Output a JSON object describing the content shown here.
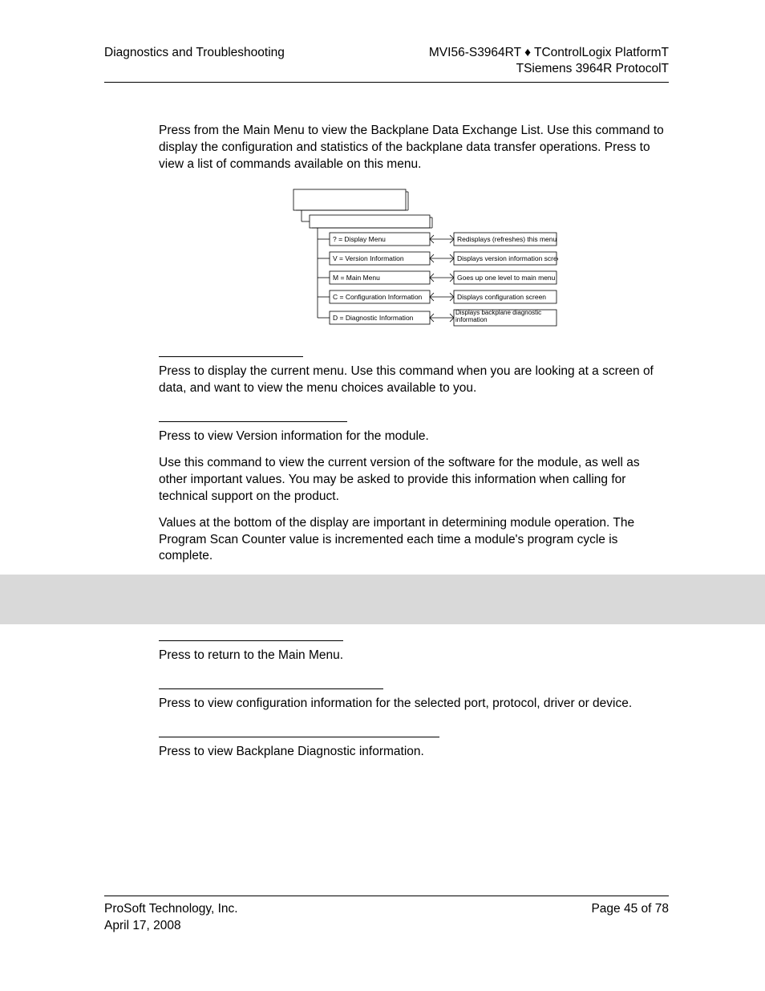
{
  "header": {
    "left": "Diagnostics and Troubleshooting",
    "right1": "MVI56-S3964RT ♦ TControlLogix PlatformT",
    "right2": "TSiemens 3964R ProtocolT"
  },
  "intro": "Press       from the Main Menu to view the Backplane Data Exchange List. Use this command to display the configuration and statistics of the backplane data transfer operations. Press       to view a list of commands available on this menu.",
  "menu_items": [
    {
      "left": "? = Display Menu",
      "right": "Redisplays (refreshes) this menu"
    },
    {
      "left": "V = Version Information",
      "right": "Displays version information screen"
    },
    {
      "left": "M = Main Menu",
      "right": "Goes up one level to main menu"
    },
    {
      "left": "C = Configuration Information",
      "right": "Displays configuration screen"
    },
    {
      "left": "D = Diagnostic Information",
      "right": "Displays backplane diagnostic information"
    }
  ],
  "sec1": "Press       to display the current menu. Use this command when you are looking at a screen of data, and want to view the menu choices available to you.",
  "sec2a": "Press       to view Version information for the module.",
  "sec2b": "Use this command to view the current version of the software for the module, as well as other important values. You may be asked to provide this information when calling for technical support on the product.",
  "sec2c": "Values at the bottom of the display are important in determining module operation. The Program Scan Counter value is incremented each time a module's program cycle is complete.",
  "sec3": "Press       to return to the Main Menu.",
  "sec4": "Press       to view configuration information for the selected port, protocol, driver or device.",
  "sec5": "Press       to view Backplane Diagnostic information.",
  "footer": {
    "company": "ProSoft Technology, Inc.",
    "date": "April 17, 2008",
    "page": "Page 45 of 78"
  }
}
